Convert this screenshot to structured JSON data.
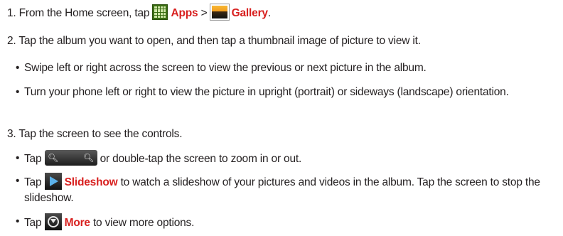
{
  "steps": [
    {
      "prefix": "1. From the Home screen, tap ",
      "apps_label": "Apps",
      "separator": " > ",
      "gallery_label": "Gallery",
      "suffix": "."
    },
    {
      "text": "2. Tap the album you want to open, and then tap a thumbnail image of picture to view it."
    },
    {
      "text": "3. Tap the screen to see the controls."
    }
  ],
  "bullets": {
    "swipe": "Swipe left or right across the screen to view the previous or next picture in the album.",
    "turn": "Turn your phone left or right to view the picture in upright (portrait) or sideways (landscape) orientation.",
    "zoom_prefix": "Tap ",
    "zoom_suffix": " or double-tap the screen to zoom in or out.",
    "slideshow_prefix": "Tap ",
    "slideshow_label": "Slideshow",
    "slideshow_suffix": " to watch a slideshow of your pictures and videos in the album. Tap the screen to stop the slideshow.",
    "more_prefix": "Tap ",
    "more_label": "More",
    "more_suffix": " to view more options."
  },
  "bullet_char": "•",
  "icons": {
    "apps": "apps-grid-icon",
    "gallery": "gallery-picture-icon",
    "zoom": "zoom-controls-icon",
    "slideshow": "slideshow-play-icon",
    "more": "more-options-icon"
  },
  "colors": {
    "text": "#231f20",
    "highlight": "#d8201f"
  }
}
